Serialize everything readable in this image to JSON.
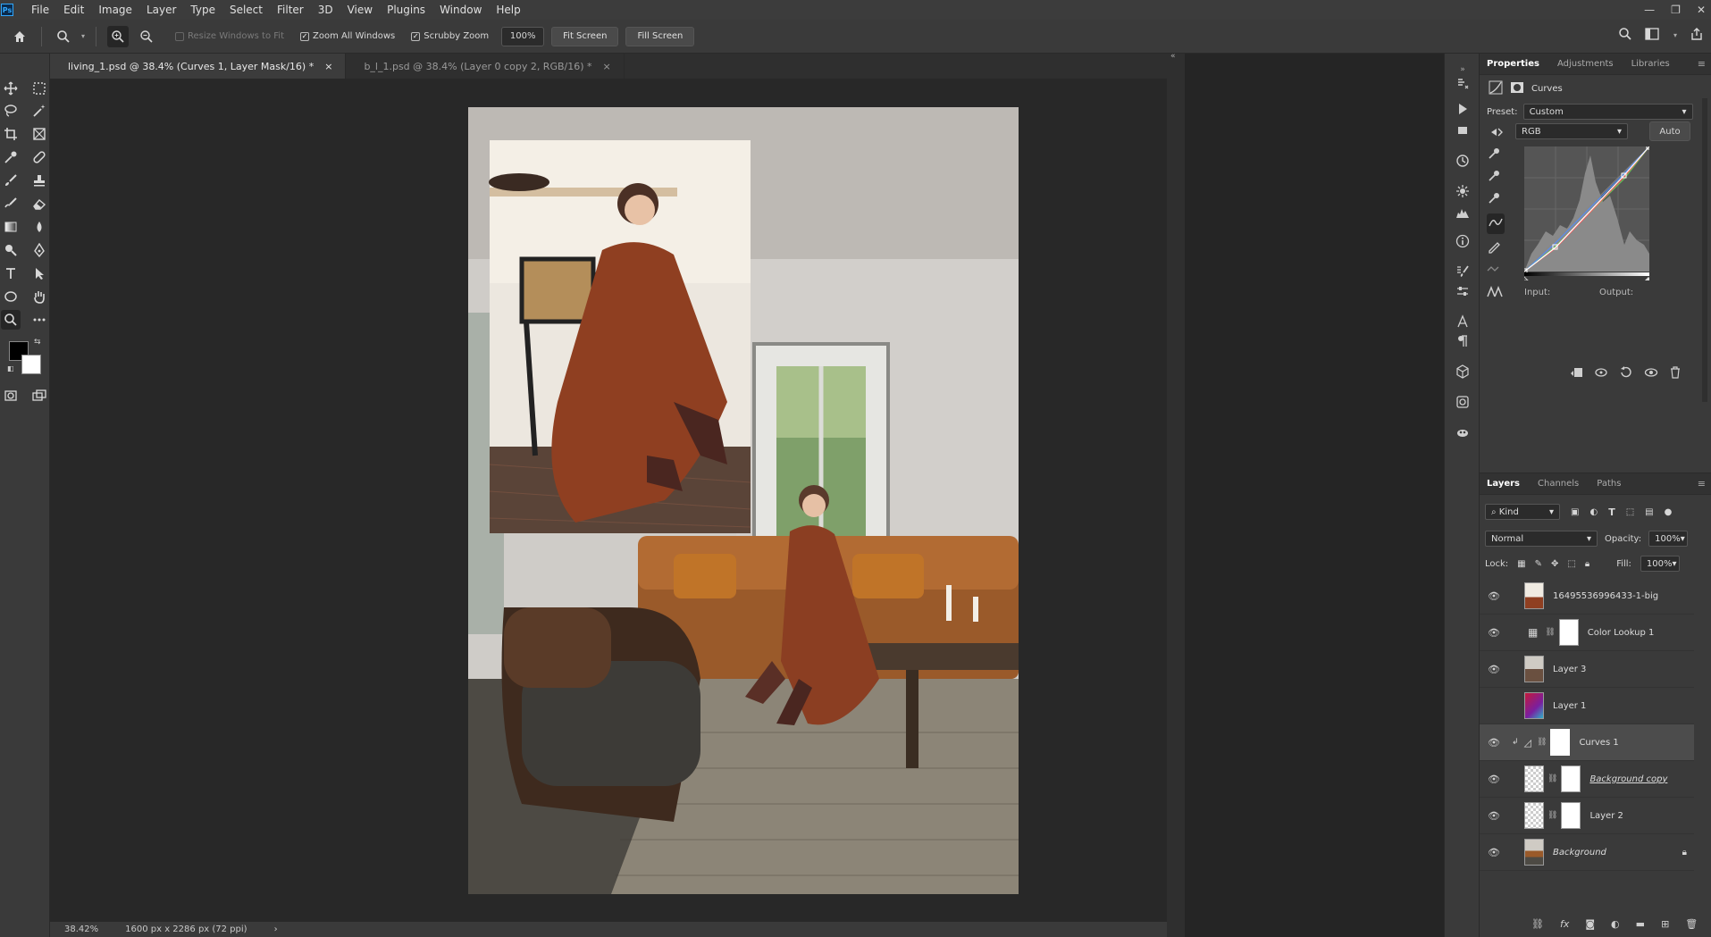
{
  "menubar": {
    "app_logo": "Ps",
    "items": [
      "File",
      "Edit",
      "Image",
      "Layer",
      "Type",
      "Select",
      "Filter",
      "3D",
      "View",
      "Plugins",
      "Window",
      "Help"
    ]
  },
  "options_bar": {
    "resize_windows": "Resize Windows to Fit",
    "zoom_all": "Zoom All Windows",
    "scrubby_zoom": "Scrubby Zoom",
    "zoom_value": "100%",
    "fit_screen": "Fit Screen",
    "fill_screen": "Fill Screen"
  },
  "tabs": [
    {
      "label": "living_1.psd @ 38.4% (Curves 1, Layer Mask/16) *",
      "close": "×"
    },
    {
      "label": "b_l_1.psd @ 38.4% (Layer 0 copy 2, RGB/16) *",
      "close": "×"
    }
  ],
  "status": {
    "zoom": "38.42%",
    "doc_size": "1600 px x 2286 px (72 ppi)",
    "arrow": "›"
  },
  "properties": {
    "tabs": [
      "Properties",
      "Adjustments",
      "Libraries"
    ],
    "title": "Curves",
    "preset_label": "Preset:",
    "preset_value": "Custom",
    "channel": "RGB",
    "auto": "Auto",
    "input_label": "Input:",
    "output_label": "Output:"
  },
  "layers_panel": {
    "tabs": [
      "Layers",
      "Channels",
      "Paths"
    ],
    "kind": "Kind",
    "blend": "Normal",
    "opacity_label": "Opacity:",
    "opacity": "100%",
    "lock_label": "Lock:",
    "fill_label": "Fill:",
    "fill": "100%",
    "layers": [
      {
        "name": "16495536996433-1-big"
      },
      {
        "name": "Color Lookup 1"
      },
      {
        "name": "Layer 3"
      },
      {
        "name": "Layer 1"
      },
      {
        "name": "Curves 1"
      },
      {
        "name": "Background copy"
      },
      {
        "name": "Layer 2"
      },
      {
        "name": "Background"
      }
    ]
  },
  "colors": {
    "accent": "#31a8ff",
    "foreground": "#000000",
    "background": "#ffffff"
  }
}
